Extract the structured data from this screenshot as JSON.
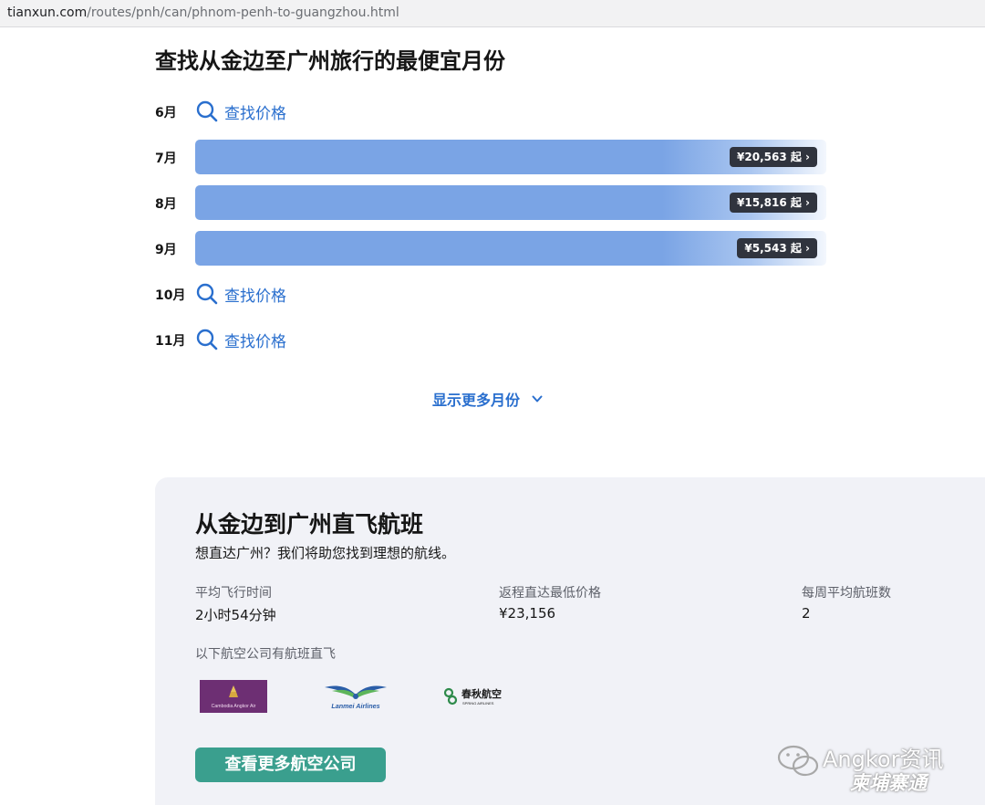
{
  "browser": {
    "url_domain": "tianxun.com",
    "url_path": "/routes/pnh/can/phnom-penh-to-guangzhou.html"
  },
  "page": {
    "title": "查找从金边至广州旅行的最便宜月份"
  },
  "months": [
    {
      "label": "6月",
      "type": "search",
      "link_text": "查找价格"
    },
    {
      "label": "7月",
      "type": "price",
      "price": "¥20,563 起 ›"
    },
    {
      "label": "8月",
      "type": "price",
      "price": "¥15,816 起 ›"
    },
    {
      "label": "9月",
      "type": "price",
      "price": "¥5,543 起 ›"
    },
    {
      "label": "10月",
      "type": "search",
      "link_text": "查找价格"
    },
    {
      "label": "11月",
      "type": "search",
      "link_text": "查找价格"
    }
  ],
  "more_months": {
    "label": "显示更多月份",
    "icon": "chevron-down-icon"
  },
  "direct": {
    "title": "从金边到广州直飞航班",
    "subtitle": "想直达广州？我们将助您找到理想的航线。",
    "stats": [
      {
        "label": "平均飞行时间",
        "value": "2小时54分钟"
      },
      {
        "label": "返程直达最低价格",
        "value": "¥23,156"
      },
      {
        "label": "每周平均航班数",
        "value": "2"
      }
    ],
    "airlines_label": "以下航空公司有航班直飞",
    "airlines": [
      {
        "name": "Cambodia Angkor Air",
        "logo_text": "Cambodia Angkor Air"
      },
      {
        "name": "Lanmei Airlines",
        "logo_text": "Lanmei Airlines"
      },
      {
        "name": "Spring Airlines",
        "logo_text": "春秋航空",
        "logo_subtext": "SPRING AIRLINES"
      }
    ],
    "button_label": "查看更多航空公司"
  },
  "watermark": {
    "line1": "Angkor资讯",
    "line2": "柬埔寨通"
  },
  "colors": {
    "link_blue": "#2a6fce",
    "bar_blue": "#7aa4e5",
    "price_tag_bg": "#30343e",
    "panel_bg": "#f1f2f7",
    "button_green": "#3a9f8e",
    "cambodia_purple": "#6d2f73"
  }
}
